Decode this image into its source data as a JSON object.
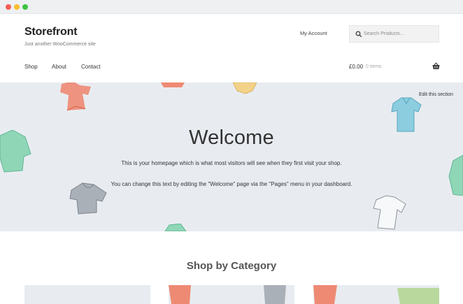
{
  "site": {
    "title": "Storefront",
    "tagline": "Just another WooCommerce site"
  },
  "header": {
    "my_account": "My Account",
    "search_placeholder": "Search Products…",
    "nav": [
      "Shop",
      "About",
      "Contact"
    ],
    "cart_total": "£0.00",
    "cart_count": "0 items"
  },
  "hero": {
    "edit_label": "Edit this section",
    "heading": "Welcome",
    "line1": "This is your homepage which is what most visitors will see when they first visit your shop.",
    "line2": "You can change this text by editing the \"Welcome\" page via the \"Pages\" menu in your dashboard."
  },
  "section": {
    "shop_by_category": "Shop by Category"
  },
  "colors": {
    "hero_bg": "#e8ecf1",
    "shirt_coral": "#ee8a73",
    "shirt_mint": "#8fd6b7",
    "shirt_sky": "#8ccde0",
    "shirt_yellow": "#f2d288",
    "shirt_grey": "#aab0b8"
  },
  "icons": [
    "search-icon",
    "basket-icon"
  ]
}
